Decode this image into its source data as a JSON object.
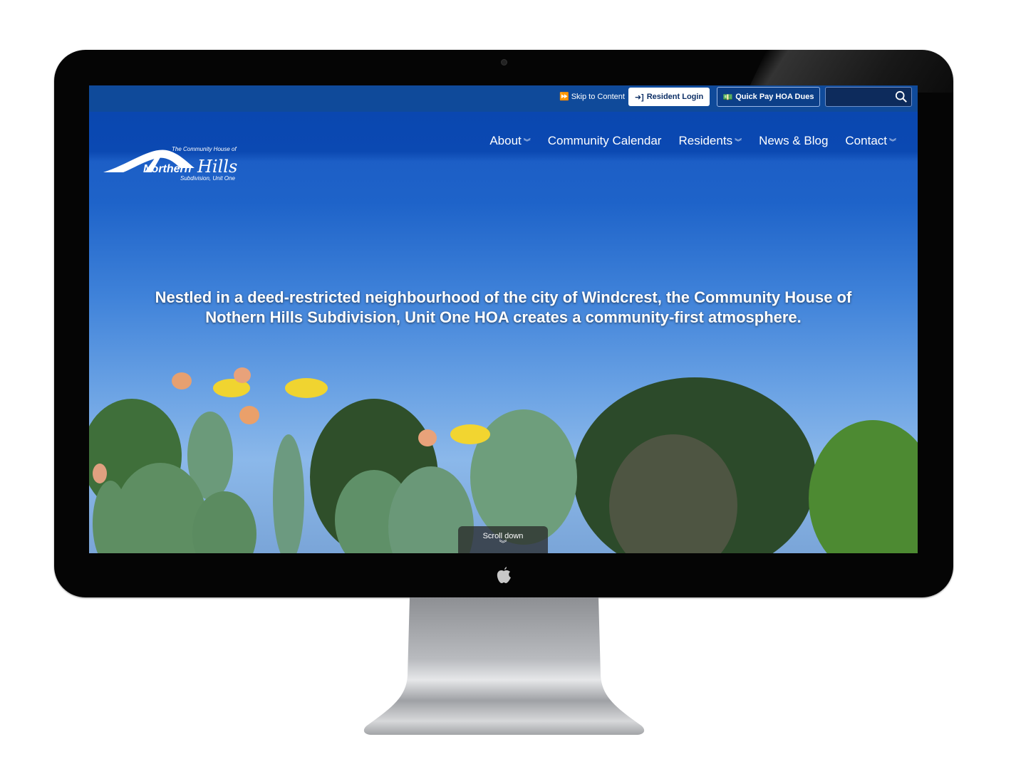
{
  "device": {
    "type": "monitor",
    "brand_logo": "apple-icon"
  },
  "topbar": {
    "skip_label": "Skip to Content",
    "skip_icon": "fast-forward-icon",
    "login_label": "Resident Login",
    "login_icon": "sign-in-icon",
    "pay_label": "Quick Pay HOA Dues",
    "pay_icon": "money-bill-icon",
    "search_value": "",
    "search_placeholder": "",
    "search_icon": "search-icon"
  },
  "logo": {
    "line1": "The Community House of",
    "name_part1": "Northern",
    "name_part2": "Hills",
    "line3": "Subdivision, Unit One"
  },
  "nav": {
    "items": [
      {
        "label": "About",
        "has_dropdown": true
      },
      {
        "label": "Community Calendar",
        "has_dropdown": false
      },
      {
        "label": "Residents",
        "has_dropdown": true
      },
      {
        "label": "News & Blog",
        "has_dropdown": false
      },
      {
        "label": "Contact",
        "has_dropdown": true
      }
    ],
    "dropdown_glyph": "»"
  },
  "hero": {
    "text": "Nestled in a deed-restricted neighbourhood of the city of Windcrest, the Community House of Nothern Hills Subdivision, Unit One HOA creates a community-first atmosphere.",
    "image_desc": "Prickly pear cactus with yellow flowers against blue sky and trees"
  },
  "scroll": {
    "label": "Scroll down",
    "icon": "double-chevron-down-icon"
  },
  "colors": {
    "primary": "#0b49b2",
    "topbar": "#0f4a9a",
    "bezel": "#050505"
  }
}
